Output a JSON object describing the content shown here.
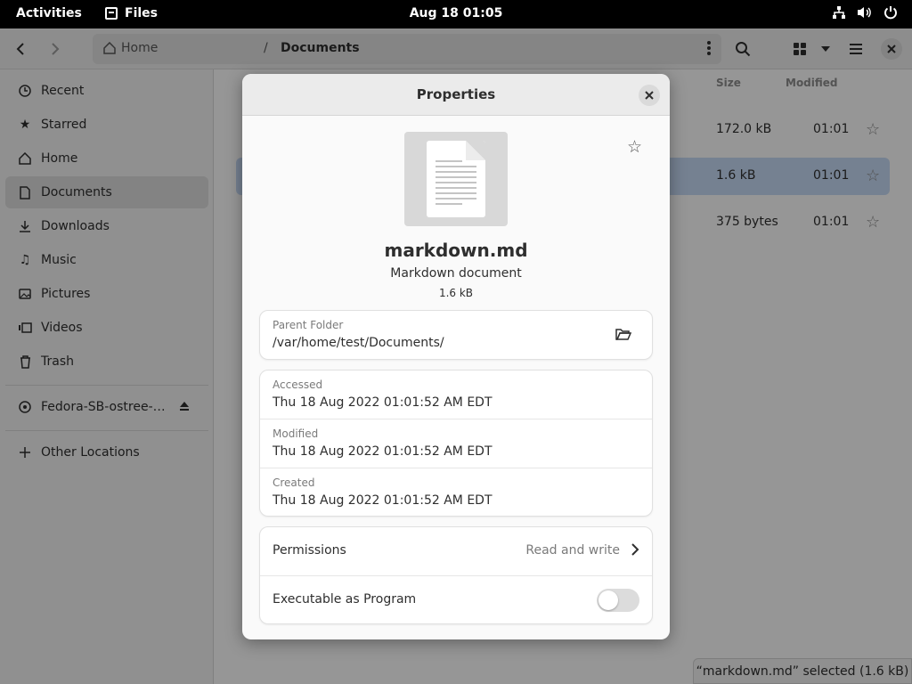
{
  "topbar": {
    "activities": "Activities",
    "app_name": "Files",
    "clock": "Aug 18  01:05"
  },
  "window": {
    "path": {
      "home": "Home",
      "separator": "/",
      "current": "Documents"
    },
    "sidebar": {
      "items": [
        {
          "label": "Recent",
          "icon": "clock-icon"
        },
        {
          "label": "Starred",
          "icon": "star-icon"
        },
        {
          "label": "Home",
          "icon": "home-icon"
        },
        {
          "label": "Documents",
          "icon": "document-icon",
          "active": true
        },
        {
          "label": "Downloads",
          "icon": "download-icon"
        },
        {
          "label": "Music",
          "icon": "music-icon"
        },
        {
          "label": "Pictures",
          "icon": "picture-icon"
        },
        {
          "label": "Videos",
          "icon": "video-icon"
        },
        {
          "label": "Trash",
          "icon": "trash-icon"
        }
      ],
      "drive": "Fedora-SB-ostree-…",
      "other": "Other Locations"
    },
    "columns": {
      "size": "Size",
      "modified": "Modified"
    },
    "rows": [
      {
        "size": "172.0 kB",
        "modified": "01:01"
      },
      {
        "size": "1.6 kB",
        "modified": "01:01",
        "selected": true
      },
      {
        "size": "375 bytes",
        "modified": "01:01"
      }
    ],
    "status": "“markdown.md” selected  (1.6 kB)"
  },
  "dialog": {
    "title": "Properties",
    "file_name": "markdown.md",
    "file_type": "Markdown document",
    "file_size": "1.6 kB",
    "parent_folder": {
      "label": "Parent Folder",
      "value": "/var/home/test/Documents/"
    },
    "accessed": {
      "label": "Accessed",
      "value": "Thu 18 Aug 2022 01:01:52 AM EDT"
    },
    "modified": {
      "label": "Modified",
      "value": "Thu 18 Aug 2022 01:01:52 AM EDT"
    },
    "created": {
      "label": "Created",
      "value": "Thu 18 Aug 2022 01:01:52 AM EDT"
    },
    "permissions": {
      "label": "Permissions",
      "value": "Read and write"
    },
    "executable": {
      "label": "Executable as Program",
      "enabled": false
    }
  },
  "colors": {
    "selection": "#c4d8f2",
    "topbar": "#000000",
    "dim_overlay": "rgba(0,0,0,0.40)"
  }
}
